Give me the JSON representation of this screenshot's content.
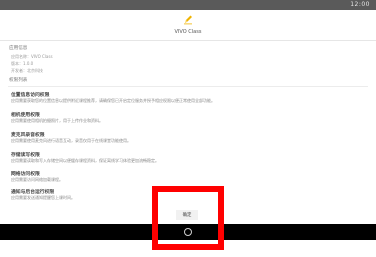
{
  "status_bar": {
    "time": "12:00"
  },
  "app": {
    "title": "VIVO Class"
  },
  "details": {
    "section_title": "应用信息",
    "rows": [
      "应用名称：VIVO Class",
      "版本：1.0.0",
      "开发者：北京科技"
    ]
  },
  "permissions": {
    "section_title": "权限列表",
    "items": [
      {
        "title": "位置信息访问权限",
        "desc": "应用需要获取您的位置信息以提供附近课程推荐，请确保您已开启定位服务并授予相应权限以便正常使用全部功能。"
      },
      {
        "title": "相机使用权限",
        "desc": "应用需要使用相机拍摄照片，用于上传作业和资料。"
      },
      {
        "title": "麦克风录音权限",
        "desc": "应用需要使用麦克风进行语音互动，录音仅用于在线课堂功能使用。"
      },
      {
        "title": "存储读写权限",
        "desc": "应用需要读取和写入存储空间以便缓存课程资料，保证离线学习体验更加流畅稳定。"
      },
      {
        "title": "网络访问权限",
        "desc": "应用需要访问网络加载课程。"
      },
      {
        "title": "通知与后台运行权限",
        "desc": "应用需要发送通知提醒您上课时间。"
      }
    ]
  },
  "actions": {
    "confirm_label": "确定"
  },
  "colors": {
    "highlight": "#ff0000",
    "logo": "#f0b400"
  },
  "icons": {
    "logo": "pencil-logo-icon",
    "home": "home-circle-icon"
  }
}
